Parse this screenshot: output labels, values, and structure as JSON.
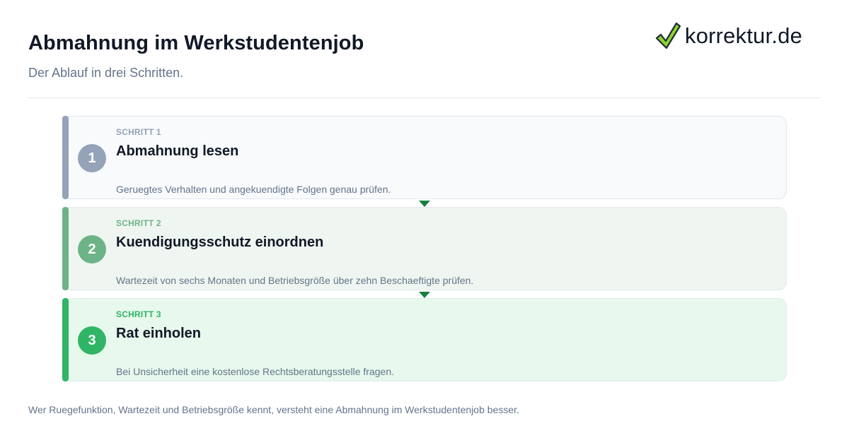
{
  "header": {
    "title": "Abmahnung im Werkstudentenjob",
    "subtitle": "Der Ablauf in drei Schritten."
  },
  "logo": {
    "text": "korrektur.de",
    "icon": "check-icon",
    "colors": {
      "check_fill": "#8bd62b",
      "check_outline": "#1f2937"
    }
  },
  "steps": [
    {
      "number": "1",
      "label": "SCHRITT 1",
      "title": "Abmahnung lesen",
      "description": "Geruegtes Verhalten und angekuendigte Folgen genau prüfen.",
      "accent": "#94a3b8"
    },
    {
      "number": "2",
      "label": "SCHRITT 2",
      "title": "Kuendigungsschutz einordnen",
      "description": "Wartezeit von sechs Monaten und Betriebsgröße über zehn Beschaeftigte prüfen.",
      "accent": "#6db387"
    },
    {
      "number": "3",
      "label": "SCHRITT 3",
      "title": "Rat einholen",
      "description": "Bei Unsicherheit eine kostenlose Rechtsberatungsstelle fragen.",
      "accent": "#2fb565"
    }
  ],
  "connector_color": "#15803d",
  "footer": {
    "note": "Wer Ruegefunktion, Wartezeit und Betriebsgröße kennt, versteht eine Abmahnung im Werkstudentenjob besser."
  }
}
